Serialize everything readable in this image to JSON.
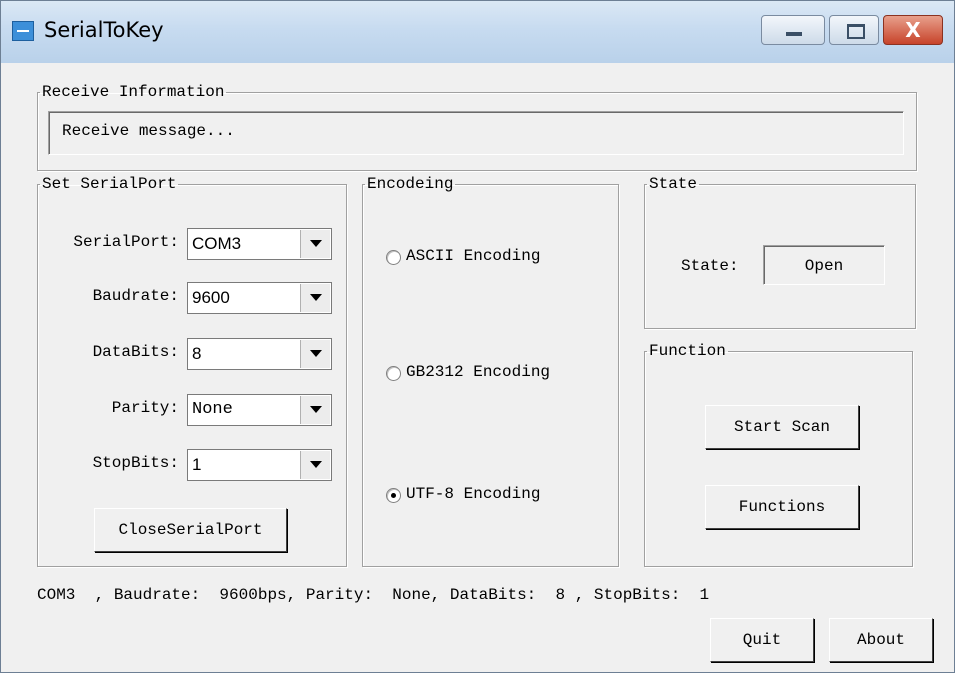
{
  "window": {
    "title": "SerialToKey",
    "controls": {
      "minimize": "minimize",
      "maximize": "maximize",
      "close": "X"
    }
  },
  "receive": {
    "legend": "Receive Information",
    "message": "Receive message..."
  },
  "serial": {
    "legend": "Set SerialPort",
    "fields": [
      {
        "label": "SerialPort:",
        "value": "COM3"
      },
      {
        "label": "Baudrate:",
        "value": "9600"
      },
      {
        "label": "DataBits:",
        "value": "8"
      },
      {
        "label": "Parity:",
        "value": "None"
      },
      {
        "label": "StopBits:",
        "value": "1"
      }
    ],
    "close_button": "CloseSerialPort"
  },
  "encoding": {
    "legend": "Encodeing",
    "options": [
      {
        "label": "ASCII Encoding",
        "checked": false
      },
      {
        "label": "GB2312 Encoding",
        "checked": false
      },
      {
        "label": "UTF-8 Encoding",
        "checked": true
      }
    ]
  },
  "state": {
    "legend": "State",
    "label": "State:",
    "value": "Open"
  },
  "function": {
    "legend": "Function",
    "start_scan": "Start Scan",
    "functions": "Functions"
  },
  "status_line": "COM3  , Baudrate:  9600bps, Parity:  None, DataBits:  8 , StopBits:  1",
  "footer": {
    "quit": "Quit",
    "about": "About"
  },
  "colors": {
    "face": "#f0f0f0",
    "titlebar": "#c7dbf0",
    "close": "#c7432a"
  }
}
